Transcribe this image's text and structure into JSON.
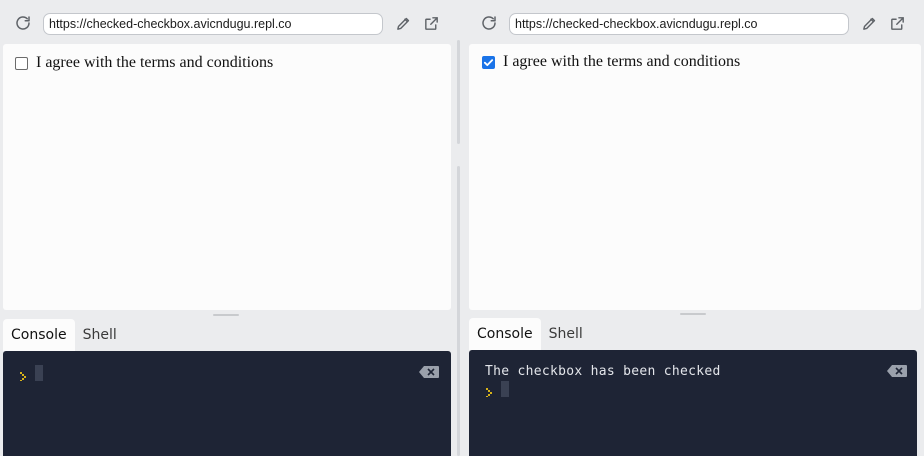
{
  "colors": {
    "accent": "#1a73e8",
    "console_bg": "#1e2435",
    "console_text": "#e3e5ea",
    "prompt_yellow": "#d7b21a"
  },
  "left": {
    "url": "https://checked-checkbox.avicndugu.repl.co",
    "checkbox_label": "I agree with the terms and conditions",
    "checkbox_checked": false,
    "tabs": {
      "console": "Console",
      "shell": "Shell"
    },
    "console_output": ""
  },
  "right": {
    "url": "https://checked-checkbox.avicndugu.repl.co",
    "checkbox_label": "I agree with the terms and conditions",
    "checkbox_checked": true,
    "tabs": {
      "console": "Console",
      "shell": "Shell"
    },
    "console_output": "The checkbox has been checked"
  },
  "icons": {
    "reload": "reload-icon",
    "edit": "pencil-icon",
    "open_external": "open-external-icon",
    "clear_console": "clear-console-icon",
    "prompt": "prompt-caret-icon"
  }
}
